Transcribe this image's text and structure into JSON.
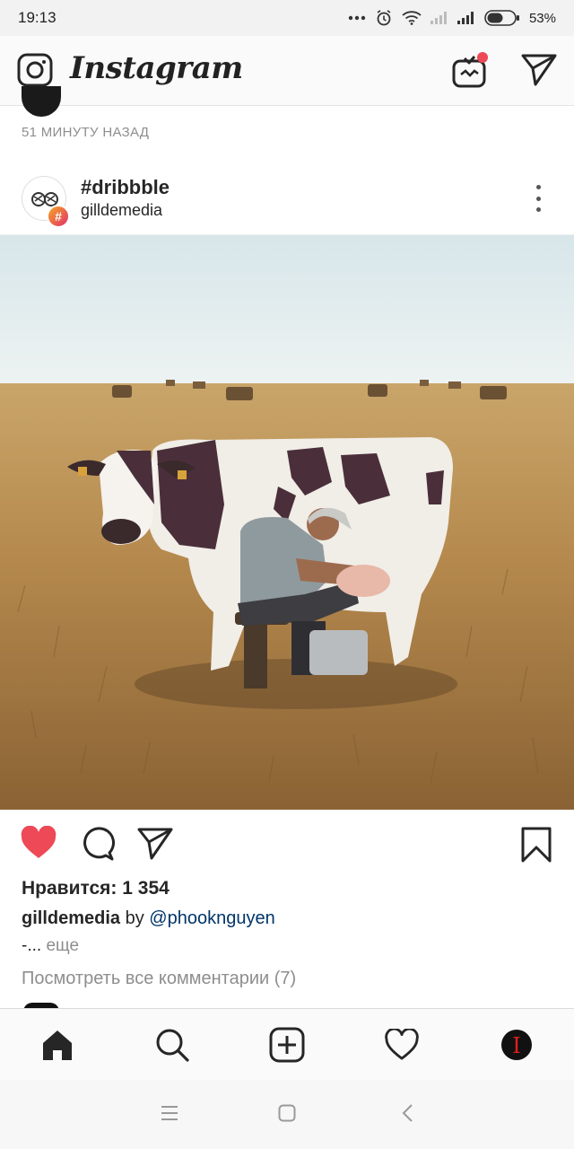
{
  "status_bar": {
    "time": "19:13",
    "battery_percent": "53%",
    "icons": [
      "more-dots-icon",
      "alarm-icon",
      "wifi-icon",
      "signal-icon",
      "signal-icon",
      "battery-icon"
    ]
  },
  "header": {
    "logo_text": "Instagram",
    "left_icon": "camera-icon",
    "right_icons": [
      "igtv-icon",
      "direct-message-icon"
    ],
    "igtv_notification_color": "#ed4956"
  },
  "previous_post": {
    "time_ago": "51 МИНУТУ НАЗАД"
  },
  "post": {
    "title": "#dribbble",
    "subtitle": "gilldemedia",
    "badge_symbol": "#",
    "likes": "Нравится: 1 354",
    "caption_user": "gilldemedia",
    "caption_by": "by",
    "caption_mention": "@phooknguyen",
    "caption_prefix": "-...",
    "caption_more": "еще",
    "view_comments": "Посмотреть все комментарии (7)",
    "liked": true,
    "like_color": "#ed4956"
  },
  "tab_bar": {
    "items": [
      "home-icon",
      "search-icon",
      "new-post-icon",
      "activity-icon",
      "profile-avatar"
    ],
    "profile_initial": "I"
  },
  "system_nav": {
    "items": [
      "menu-icon",
      "home-square-icon",
      "back-icon"
    ]
  }
}
